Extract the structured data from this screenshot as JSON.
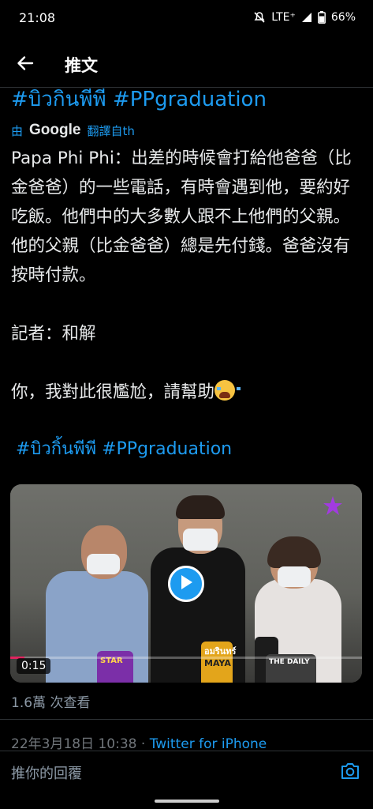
{
  "status_bar": {
    "time": "21:08",
    "network": "LTE⁺",
    "battery": "66%",
    "icons": [
      "mute-icon",
      "signal-icon",
      "battery-icon"
    ]
  },
  "nav": {
    "back_icon": "arrow-left-icon",
    "title": "推文"
  },
  "tweet": {
    "hashtag_top": "#บิวกินพีพี #PPgraduation",
    "translated_by": "由",
    "translated_google": "Google",
    "translated_from": "翻譯自th",
    "paragraphs": [
      "Papa Phi Phi：出差的時候會打給他爸爸（比金爸爸）的一些電話，有時會遇到他，要約好吃飯。他們中的大多數人跟不上他們的父親。他的父親（比金爸爸）總是先付錢。爸爸沒有按時付款。",
      "記者：和解",
      "你，我對此很尷尬，請幫助"
    ],
    "hashtag_bottom": "#บิวกิ้นพีพี #PPgraduation",
    "video": {
      "timecode": "0:15",
      "progress": 0.04,
      "play_icon": "play-icon",
      "mic_labels": [
        "อมรินทร์",
        "MAYA",
        "อมรินทร์",
        "THE DAILY",
        "STAR"
      ]
    },
    "views": "1.6萬 次查看",
    "date_time": "22年3月18日 10:38",
    "separator": " · ",
    "source": "Twitter for iPhone"
  },
  "reply": {
    "placeholder": "推你的回覆",
    "camera_icon": "camera-icon"
  },
  "colors": {
    "accent": "#1d9bf0",
    "background": "#000000",
    "text": "#e7e9ea",
    "muted": "#8b98a5"
  }
}
